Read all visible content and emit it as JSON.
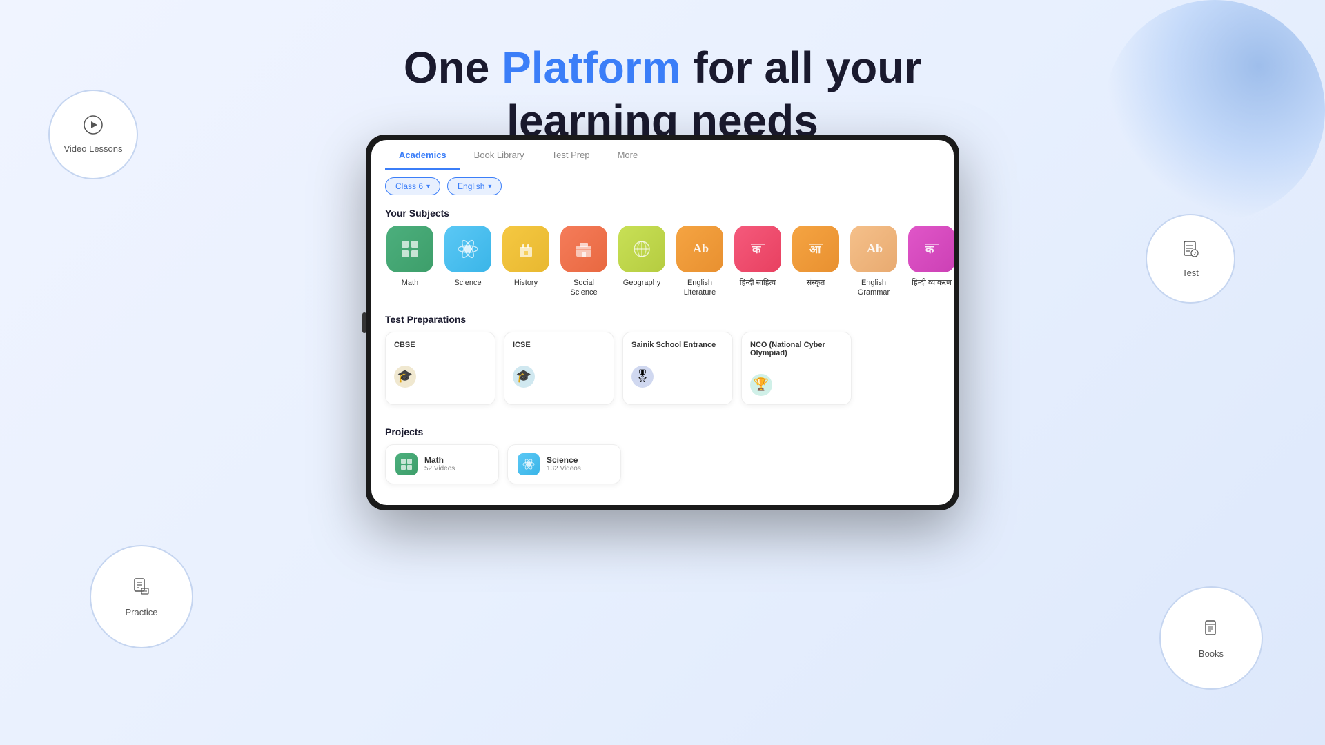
{
  "page": {
    "heading_part1": "One ",
    "heading_highlight": "Platform",
    "heading_part2": " for all your",
    "heading_line2": "learning needs"
  },
  "circles": {
    "video_lessons": {
      "label": "Video Lessons"
    },
    "practice": {
      "label": "Practice"
    },
    "test": {
      "label": "Test"
    },
    "books": {
      "label": "Books"
    }
  },
  "app": {
    "nav_tabs": [
      {
        "id": "academics",
        "label": "Academics",
        "active": true
      },
      {
        "id": "book-library",
        "label": "Book Library",
        "active": false
      },
      {
        "id": "test-prep",
        "label": "Test Prep",
        "active": false
      },
      {
        "id": "more",
        "label": "More",
        "active": false
      }
    ],
    "filters": [
      {
        "id": "class",
        "label": "Class 6",
        "type": "blue"
      },
      {
        "id": "language",
        "label": "English",
        "type": "blue"
      }
    ],
    "subjects_section_title": "Your Subjects",
    "subjects": [
      {
        "id": "math",
        "label": "Math",
        "color": "bg-green",
        "icon": "⊞"
      },
      {
        "id": "science",
        "label": "Science",
        "color": "bg-blue",
        "icon": "⚛"
      },
      {
        "id": "history",
        "label": "History",
        "color": "bg-yellow",
        "icon": "🏛"
      },
      {
        "id": "social-science",
        "label": "Social Science",
        "color": "bg-coral",
        "icon": "🏫"
      },
      {
        "id": "geography",
        "label": "Geography",
        "color": "bg-lime",
        "icon": "🌍"
      },
      {
        "id": "english-lit",
        "label": "English Literature",
        "color": "bg-orange",
        "icon": "Aa"
      },
      {
        "id": "hindi-sahitya",
        "label": "हिन्दी साहित्य",
        "color": "bg-red",
        "icon": "क"
      },
      {
        "id": "sanskrit",
        "label": "संस्कृत",
        "color": "bg-orange2",
        "icon": "आ"
      },
      {
        "id": "english-grammar",
        "label": "English Grammar",
        "color": "bg-orange3",
        "icon": "Aa"
      },
      {
        "id": "hindi-vyakaran",
        "label": "हिन्दी व्याकरण",
        "color": "bg-pink",
        "icon": "क"
      }
    ],
    "test_prep_section_title": "Test Preparations",
    "test_preps": [
      {
        "id": "cbse",
        "label": "CBSE",
        "icon": "🎓"
      },
      {
        "id": "icse",
        "label": "ICSE",
        "icon": "🎓"
      },
      {
        "id": "sainik",
        "label": "Sainik School Entrance",
        "icon": "🎖"
      },
      {
        "id": "nco",
        "label": "NCO (National Cyber Olympiad)",
        "icon": "🏆"
      }
    ],
    "projects_section_title": "Projects",
    "projects": [
      {
        "id": "math-proj",
        "name": "Math",
        "count": "52 Videos",
        "color": "bg-green",
        "icon": "⊞"
      },
      {
        "id": "science-proj",
        "name": "Science",
        "count": "132 Videos",
        "color": "bg-blue",
        "icon": "⚛"
      }
    ]
  }
}
